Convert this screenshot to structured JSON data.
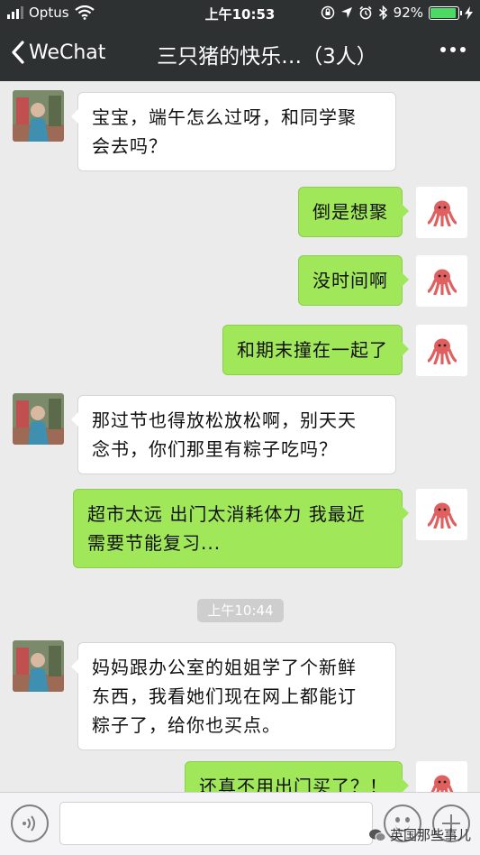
{
  "status_bar": {
    "carrier": "Optus",
    "time": "上午10:53",
    "battery_percent": "92%",
    "battery_level": 0.92
  },
  "nav": {
    "back_label": "WeChat",
    "title": "三只猪的快乐…（3人）"
  },
  "messages": [
    {
      "side": "in",
      "text_lines": [
        "宝宝，端午怎么过呀，和同学聚",
        "会去吗？"
      ]
    },
    {
      "side": "out",
      "text_lines": [
        "倒是想聚"
      ]
    },
    {
      "side": "out",
      "text_lines": [
        "没时间啊"
      ]
    },
    {
      "side": "out",
      "text_lines": [
        "和期末撞在一起了"
      ]
    },
    {
      "side": "in",
      "text_lines": [
        "那过节也得放松放松啊，别天天",
        "念书，你们那里有粽子吃吗？"
      ]
    },
    {
      "side": "out",
      "text_lines": [
        "超市太远 出门太消耗体力 我最近",
        "需要节能复习..."
      ]
    },
    {
      "side": "in",
      "text_lines": [
        "妈妈跟办公室的姐姐学了个新鲜",
        "东西，我看她们现在网上都能订",
        "粽子了，给你也买点。"
      ]
    },
    {
      "side": "out",
      "text_lines": [
        "还真不用出门买了？！"
      ]
    }
  ],
  "timestamp": "上午10:44",
  "input": {
    "placeholder": ""
  },
  "watermark": "英国那些事儿",
  "icons": {
    "signal": "signal-bars-icon",
    "wifi": "wifi-icon",
    "lock": "rotation-lock-icon",
    "location": "location-arrow-icon",
    "alarm": "alarm-clock-icon",
    "bluetooth": "bluetooth-icon",
    "charging": "bolt-icon",
    "back": "chevron-left-icon",
    "more": "more-dots-icon",
    "voice": "voice-icon",
    "emoji": "emoji-icon",
    "plus": "plus-icon",
    "octopus_avatar": "octopus-icon"
  },
  "colors": {
    "nav_bg": "#2e3132",
    "chat_bg": "#ebebeb",
    "bubble_out": "#a0e75a",
    "bubble_in": "#ffffff"
  }
}
